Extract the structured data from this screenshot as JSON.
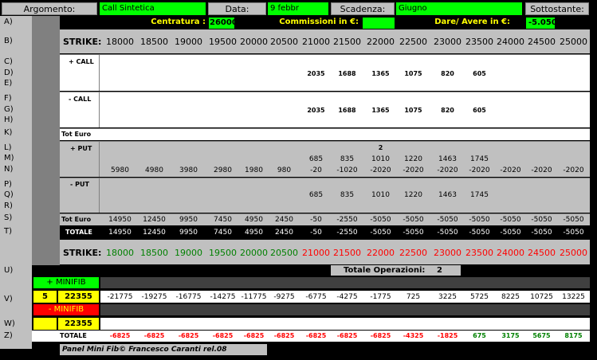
{
  "header": {
    "argomento_label": "Argomento:",
    "argomento_value": "Call Sintetica",
    "data_label": "Data:",
    "data_value": "9 febbr",
    "scadenza_label": "Scadenza:",
    "scadenza_value": "Giugno",
    "sottostante_label": "Sottostante:",
    "sottostante_value": ""
  },
  "row_a": {
    "centratura_label": "Centratura :",
    "centratura_value": "26000",
    "commissioni_label": "Commissioni in €:",
    "commissioni_value": "",
    "dare_avere_label": "Dare/ Avere in €:",
    "dare_avere_value": "-5.050"
  },
  "row_labels": [
    "A)",
    "B)",
    "C)",
    "D)",
    "E)",
    "F)",
    "G)",
    "H)",
    "K)",
    "L)",
    "M)",
    "N)",
    "P)",
    "Q)",
    "R)",
    "S)",
    "T)",
    "U)",
    "V)",
    "W)",
    "Z)"
  ],
  "strike_label": "STRIKE:",
  "strikes": [
    "18000",
    "18500",
    "19000",
    "19500",
    "20000",
    "20500",
    "21000",
    "21500",
    "22000",
    "22500",
    "23000",
    "23500",
    "24000",
    "24500",
    "25000"
  ],
  "plus_call_label": "+ CALL",
  "plus_call_values": [
    "",
    "",
    "",
    "",
    "",
    "",
    "2035",
    "1688",
    "1365",
    "1075",
    "820",
    "605",
    "",
    "",
    ""
  ],
  "minus_call_label": "- CALL",
  "minus_call_values": [
    "",
    "",
    "",
    "",
    "",
    "",
    "2035",
    "1688",
    "1365",
    "1075",
    "820",
    "605",
    "",
    "",
    ""
  ],
  "tot_euro_call_label": "Tot Euro",
  "plus_put_label": "+ PUT",
  "plus_put_qty": [
    "",
    "",
    "",
    "",
    "",
    "",
    "",
    "",
    "2",
    "",
    "",
    "",
    "",
    "",
    ""
  ],
  "plus_put_prices": [
    "",
    "",
    "",
    "",
    "",
    "",
    "685",
    "835",
    "1010",
    "1220",
    "1463",
    "1745",
    "",
    "",
    ""
  ],
  "plus_put_results": [
    "5980",
    "4980",
    "3980",
    "2980",
    "1980",
    "980",
    "-20",
    "-1020",
    "-2020",
    "-2020",
    "-2020",
    "-2020",
    "-2020",
    "-2020",
    "-2020"
  ],
  "minus_put_label": "- PUT",
  "minus_put_prices": [
    "",
    "",
    "",
    "",
    "",
    "",
    "685",
    "835",
    "1010",
    "1220",
    "1463",
    "1745",
    "",
    "",
    ""
  ],
  "tot_euro_put_label": "Tot Euro",
  "tot_euro_put_values": [
    "14950",
    "12450",
    "9950",
    "7450",
    "4950",
    "2450",
    "-50",
    "-2550",
    "-5050",
    "-5050",
    "-5050",
    "-5050",
    "-5050",
    "-5050",
    "-5050"
  ],
  "totale_label": "TOTALE",
  "totale_values": [
    "14950",
    "12450",
    "9950",
    "7450",
    "4950",
    "2450",
    "-50",
    "-2550",
    "-5050",
    "-5050",
    "-5050",
    "-5050",
    "-5050",
    "-5050",
    "-5050"
  ],
  "strike_colors": [
    "green",
    "green",
    "green",
    "green",
    "green",
    "green",
    "red",
    "red",
    "red",
    "red",
    "red",
    "red",
    "red",
    "red",
    "red"
  ],
  "totale_operazioni_label": "Totale Operazioni:",
  "totale_operazioni_value": "2",
  "plus_minifib_label": "+ MINIFIB",
  "plus_minifib_qty": "5",
  "plus_minifib_price": "22355",
  "plus_minifib_values": [
    "-21775",
    "-19275",
    "-16775",
    "-14275",
    "-11775",
    "-9275",
    "-6775",
    "-4275",
    "-1775",
    "725",
    "3225",
    "5725",
    "8225",
    "10725",
    "13225"
  ],
  "minus_minifib_label": "- MINIFIB",
  "minus_minifib_qty": "",
  "minus_minifib_price": "22355",
  "totale_z_label": "TOTALE",
  "totale_z_values": [
    "-6825",
    "-6825",
    "-6825",
    "-6825",
    "-6825",
    "-6825",
    "-6825",
    "-6825",
    "-6825",
    "-4325",
    "-1825",
    "675",
    "3175",
    "5675",
    "8175"
  ],
  "footer_text": "Panel Mini Fib©  Francesco Caranti  rel.08",
  "colors": {
    "green_field": "#00ff00",
    "yellow_field": "#ffff00",
    "red_field": "#ff0000",
    "gray_panel": "#c0c0c0",
    "positive_text": "#008000",
    "negative_text": "#ff0000"
  }
}
